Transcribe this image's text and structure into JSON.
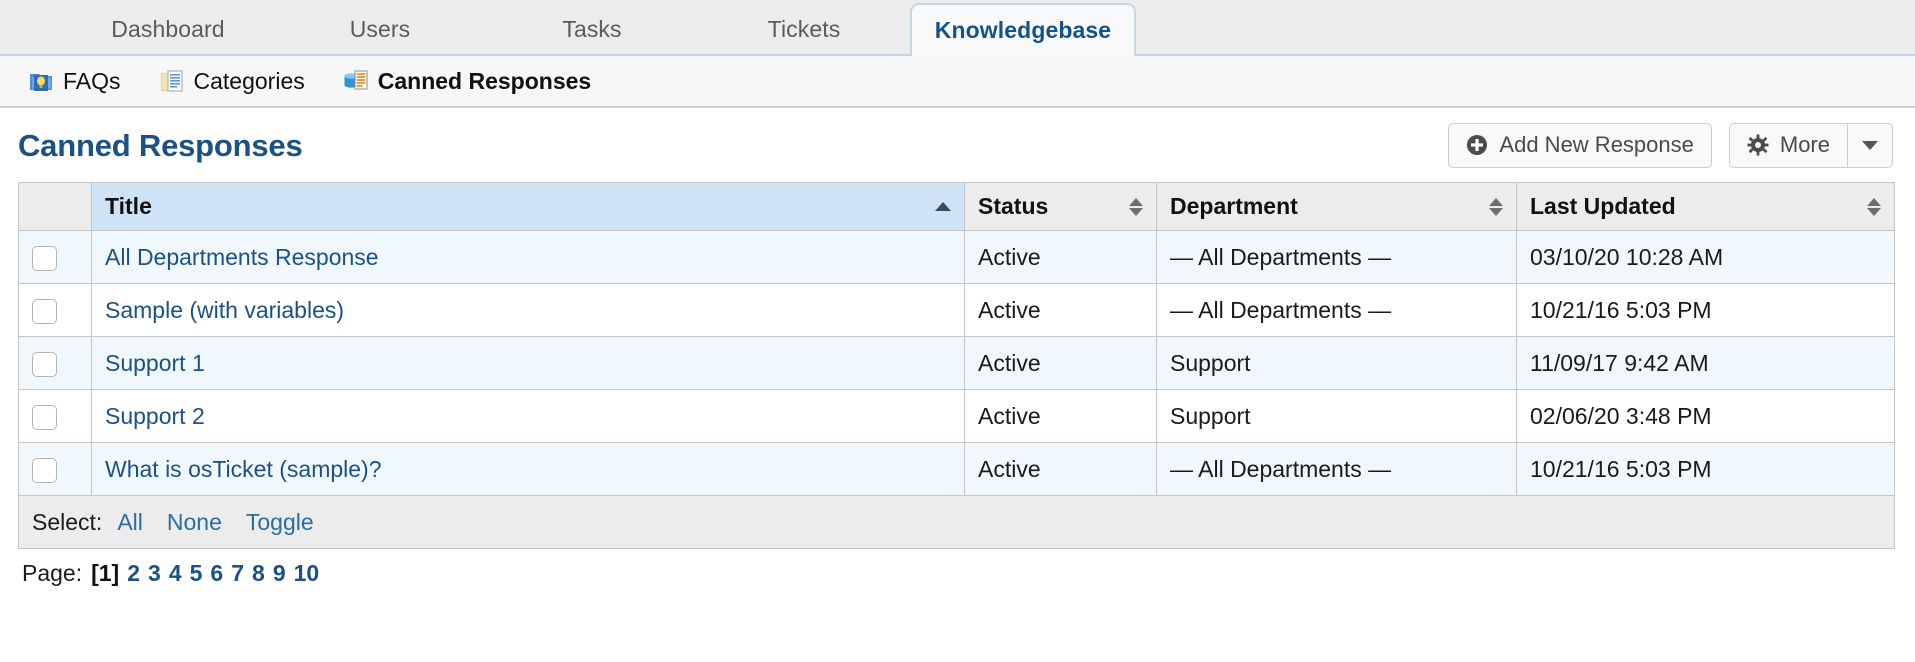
{
  "topnav": {
    "tabs": [
      {
        "label": "Dashboard",
        "active": false
      },
      {
        "label": "Users",
        "active": false
      },
      {
        "label": "Tasks",
        "active": false
      },
      {
        "label": "Tickets",
        "active": false
      },
      {
        "label": "Knowledgebase",
        "active": true
      }
    ]
  },
  "subnav": {
    "items": [
      {
        "label": "FAQs",
        "icon": "faq-folder-icon",
        "active": false
      },
      {
        "label": "Categories",
        "icon": "categories-folder-icon",
        "active": false
      },
      {
        "label": "Canned Responses",
        "icon": "canned-responses-icon",
        "active": true
      }
    ]
  },
  "page": {
    "title": "Canned Responses",
    "add_button": "Add New Response",
    "more_button": "More"
  },
  "table": {
    "columns": [
      {
        "key": "check",
        "label": "",
        "sort": "none"
      },
      {
        "key": "title",
        "label": "Title",
        "sort": "asc"
      },
      {
        "key": "status",
        "label": "Status",
        "sort": "both"
      },
      {
        "key": "department",
        "label": "Department",
        "sort": "both"
      },
      {
        "key": "updated",
        "label": "Last Updated",
        "sort": "both"
      }
    ],
    "rows": [
      {
        "title": "All Departments Response",
        "status": "Active",
        "department": "— All Departments —",
        "updated": "03/10/20 10:28 AM",
        "checked": false
      },
      {
        "title": "Sample (with variables)",
        "status": "Active",
        "department": "— All Departments —",
        "updated": "10/21/16 5:03 PM",
        "checked": false
      },
      {
        "title": "Support 1",
        "status": "Active",
        "department": "Support",
        "updated": "11/09/17 9:42 AM",
        "checked": false
      },
      {
        "title": "Support 2",
        "status": "Active",
        "department": "Support",
        "updated": "02/06/20 3:48 PM",
        "checked": false
      },
      {
        "title": "What is osTicket (sample)?",
        "status": "Active",
        "department": "— All Departments —",
        "updated": "10/21/16 5:03 PM",
        "checked": false
      }
    ],
    "footer": {
      "select_label": "Select:",
      "select_all": "All",
      "select_none": "None",
      "select_toggle": "Toggle"
    }
  },
  "pagination": {
    "label": "Page:",
    "current": "[1]",
    "pages": [
      "2",
      "3",
      "4",
      "5",
      "6",
      "7",
      "8",
      "9",
      "10"
    ]
  },
  "colors": {
    "accent": "#1b5184",
    "tab_border": "#c3d7e8",
    "sorted_header": "#cfe3f7",
    "row_odd": "#f1f8fd",
    "header_grey": "#ececec"
  }
}
